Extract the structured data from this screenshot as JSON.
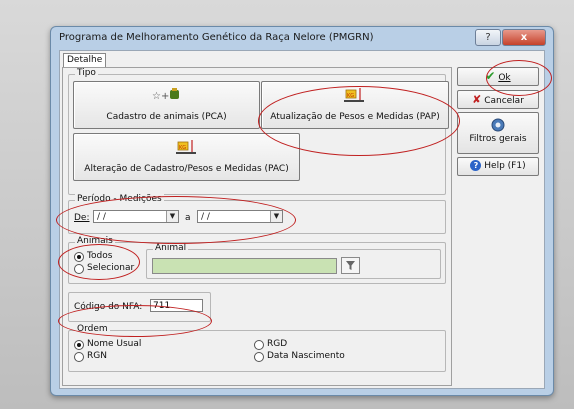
{
  "window": {
    "title": "Programa de Melhoramento Genético da Raça Nelore (PMGRN)",
    "help_glyph": "?",
    "close_glyph": "x"
  },
  "tab_label": "Detalhe",
  "tipo": {
    "group_label": "Tipo",
    "pca_label": "Cadastro de animais (PCA)",
    "pap_label": "Atualização de Pesos e Medidas (PAP)",
    "pac_label": "Alteração de Cadastro/Pesos e Medidas (PAC)",
    "icons": [
      "animals-add-icon",
      "scale-icon",
      "scale-icon"
    ]
  },
  "periodo": {
    "group_label": "Período - Medições",
    "de_label": "De:",
    "from_value": " / /",
    "a_label": "a",
    "to_value": " / /"
  },
  "animais": {
    "group_label": "Animais",
    "todos_label": "Todos",
    "selecionar_label": "Selecionar",
    "animal_label": "Animal",
    "animal_value": ""
  },
  "nfa": {
    "label": "Código do NFA:",
    "value": "711"
  },
  "ordem": {
    "group_label": "Ordem",
    "options": [
      "Nome Usual",
      "RGN",
      "RGD",
      "Data Nascimento"
    ],
    "selected": "Nome Usual"
  },
  "side_buttons": {
    "ok_label": "Ok",
    "cancel_label": "Cancelar",
    "filters_label": "Filtros gerais",
    "help_label": "Help (F1)"
  },
  "colors": {
    "annotation_red": "#c02020",
    "animal_field_green": "#c9e2b3"
  }
}
